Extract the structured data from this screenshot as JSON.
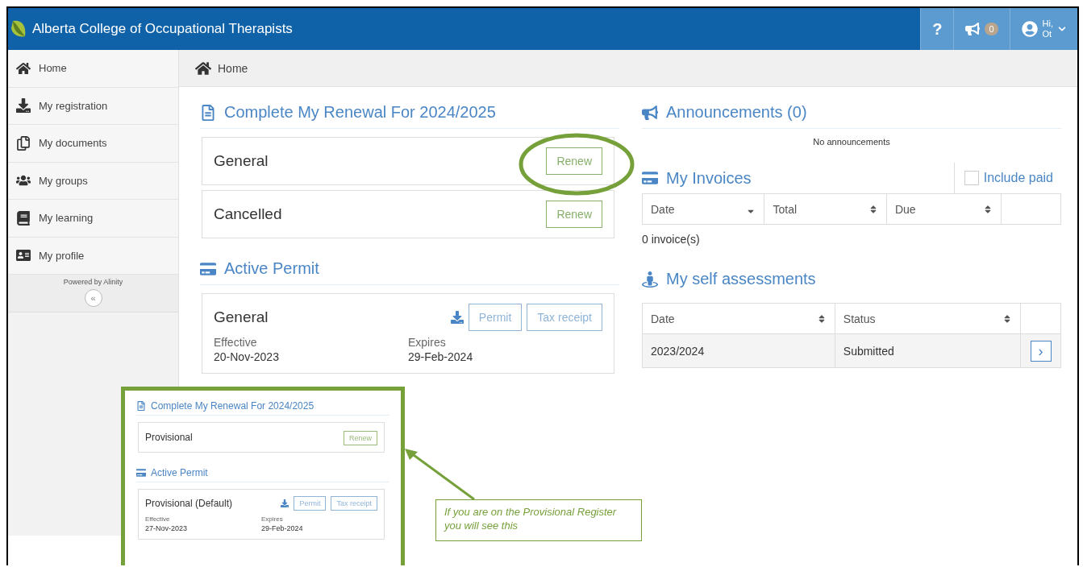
{
  "header": {
    "title": "Alberta College of Occupational Therapists",
    "help": "?",
    "notifications": "0",
    "greeting": "Hi,",
    "user": "Ot"
  },
  "sidebar": {
    "items": [
      {
        "label": "Home"
      },
      {
        "label": "My registration"
      },
      {
        "label": "My documents"
      },
      {
        "label": "My groups"
      },
      {
        "label": "My learning"
      },
      {
        "label": "My profile"
      }
    ],
    "footer": "Powered by Alinity",
    "collapse": "«"
  },
  "breadcrumb": "Home",
  "renewal": {
    "title": "Complete My Renewal For 2024/2025",
    "rows": [
      {
        "label": "General",
        "button": "Renew",
        "highlighted": true
      },
      {
        "label": "Cancelled",
        "button": "Renew",
        "highlighted": false
      }
    ]
  },
  "permit": {
    "title": "Active Permit",
    "name": "General",
    "buttons": [
      "Permit",
      "Tax receipt"
    ],
    "fields": [
      {
        "label": "Effective",
        "value": "20-Nov-2023"
      },
      {
        "label": "Expires",
        "value": "29-Feb-2024"
      }
    ]
  },
  "announcements": {
    "title": "Announcements (0)",
    "empty": "No announcements"
  },
  "invoices": {
    "title": "My Invoices",
    "include_paid": {
      "label": "Include paid",
      "checked": false
    },
    "columns": [
      {
        "label": "Date",
        "sorted": true
      },
      {
        "label": "Total",
        "sorted": false
      },
      {
        "label": "Due",
        "sorted": false
      }
    ],
    "footer": "0 invoice(s)"
  },
  "assessments": {
    "title": "My self assessments",
    "columns": [
      {
        "label": "Date",
        "sorted": false
      },
      {
        "label": "Status",
        "sorted": false
      }
    ],
    "rows": [
      {
        "date": "2023/2024",
        "status": "Submitted",
        "action": "›"
      }
    ]
  },
  "inset": {
    "renewal": {
      "title": "Complete My Renewal For 2024/2025",
      "rows": [
        {
          "label": "Provisional",
          "button": "Renew",
          "highlighted": false
        }
      ]
    },
    "permit": {
      "title": "Active Permit",
      "name": "Provisional (Default)",
      "buttons": [
        "Permit",
        "Tax receipt"
      ],
      "fields": [
        {
          "label": "Effective",
          "value": "27-Nov-2023"
        },
        {
          "label": "Expires",
          "value": "29-Feb-2024"
        }
      ]
    }
  },
  "callout": {
    "text": "If you are on the Provisional Register you will see this"
  }
}
